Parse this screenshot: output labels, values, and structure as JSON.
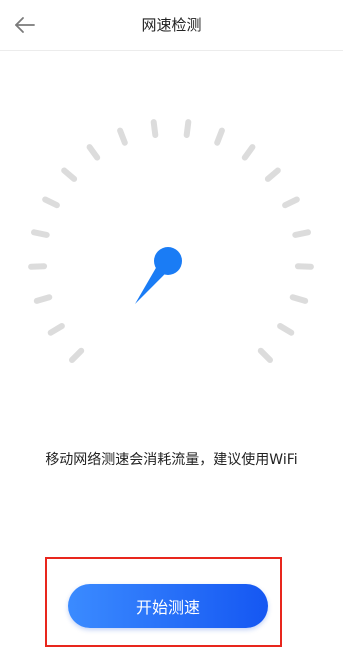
{
  "header": {
    "back_icon": "arrow-left-icon",
    "title": "网速检测"
  },
  "gauge": {
    "needle_color": "#1a7cf5",
    "tick_color": "#dcdcdc"
  },
  "notice": {
    "text": "移动网络测速会消耗流量，建议使用WiFi"
  },
  "actions": {
    "start_label": "开始测速",
    "button_color_start": "#3b8bff",
    "button_color_end": "#1557f2",
    "highlight_color": "#e8261d"
  }
}
